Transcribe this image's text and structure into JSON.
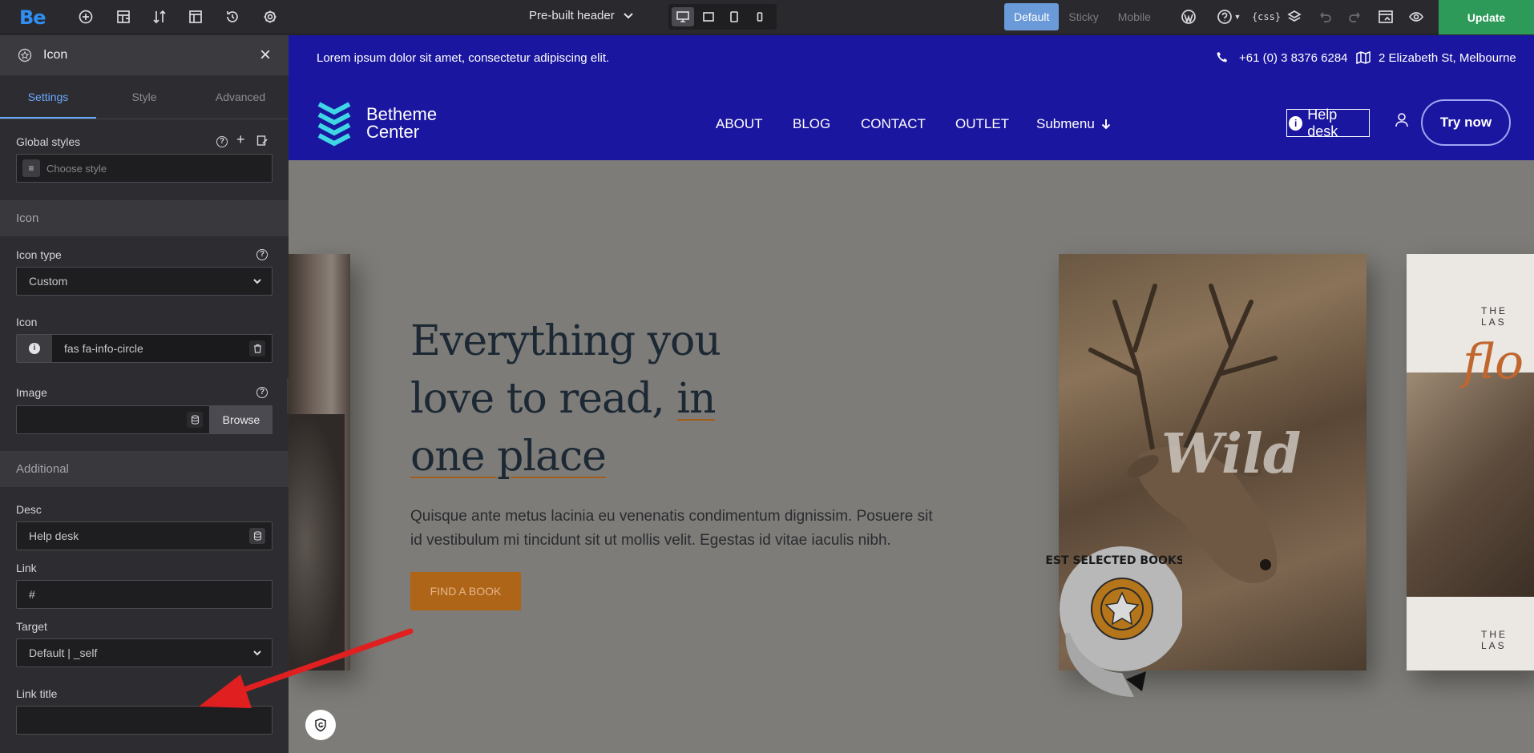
{
  "app": {
    "logo": "Be",
    "header_selector": "Pre-built header",
    "update_label": "Update"
  },
  "toolbar": {
    "icons": [
      "add-icon",
      "structure-icon",
      "sort-icon",
      "templates-icon",
      "history-icon",
      "settings-icon"
    ],
    "modes": [
      "Default",
      "Sticky",
      "Mobile"
    ],
    "active_mode": "Default"
  },
  "panel": {
    "title": "Icon",
    "tabs": [
      "Settings",
      "Style",
      "Advanced"
    ],
    "global_styles_label": "Global styles",
    "global_styles_placeholder": "Choose style",
    "section_icon": "Icon",
    "icon_type_label": "Icon type",
    "icon_type_value": "Custom",
    "icon_label": "Icon",
    "icon_value": "fas fa-info-circle",
    "image_label": "Image",
    "browse_label": "Browse",
    "section_additional": "Additional",
    "desc_label": "Desc",
    "desc_value": "Help desk",
    "link_label": "Link",
    "link_value": "#",
    "target_label": "Target",
    "target_value": "Default | _self",
    "link_title_label": "Link title",
    "link_title_value": ""
  },
  "site": {
    "topbar_text": "Lorem ipsum dolor sit amet, consectetur adipiscing elit.",
    "phone": "+61 (0) 3 8376 6284",
    "address": "2 Elizabeth St, Melbourne",
    "brand_line1": "Betheme",
    "brand_line2": "Center",
    "nav": [
      "ABOUT",
      "BLOG",
      "CONTACT",
      "OUTLET",
      "Submenu"
    ],
    "help_desk": "Help desk",
    "try_now": "Try now",
    "hero_line1": "Everything you",
    "hero_line2a": "love to read,",
    "hero_line2b": "in",
    "hero_line3": "one place",
    "hero_desc": "Quisque ante metus lacinia eu venenatis condimentum dignissim. Posuere sit id vestibulum mi tincidunt sit ut mollis velit. Egestas id vitae iaculis nibh.",
    "cta": "FIND A BOOK",
    "book_word": "Wild",
    "badge_text": "THE BEST SELECTED BOOKS ON THE",
    "right_book_top": "THE LAS",
    "right_book_script": "flo",
    "right_book_bottom": "THE LAS"
  },
  "colors": {
    "accent": "#6aa9ff",
    "site_blue": "#1b169f",
    "update_green": "#2e9a5a",
    "cta": "#ae6518",
    "arrow": "#e02020"
  }
}
